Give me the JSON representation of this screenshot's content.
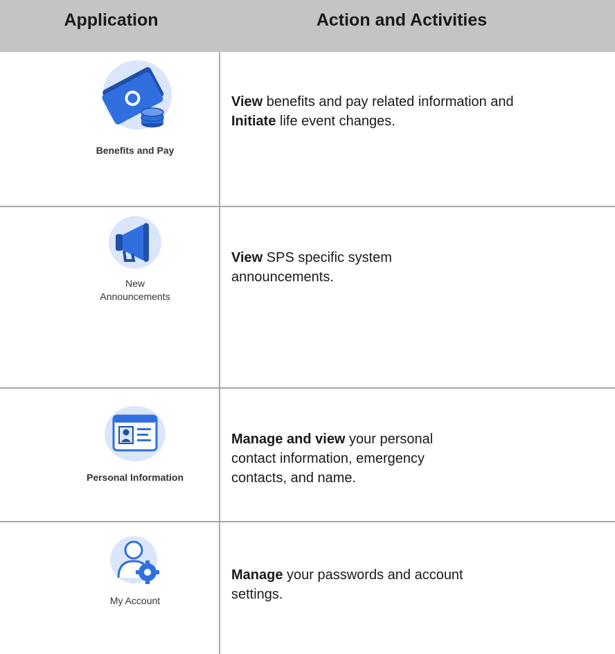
{
  "header": {
    "application": "Application",
    "actions": "Action and Activities"
  },
  "rows": [
    {
      "app_label": "Benefits and Pay",
      "icon": "money-coins-icon",
      "lines": [
        {
          "bold": "View",
          "text": " benefits and pay related information and"
        },
        {
          "bold": "Initiate",
          "text": " life event changes."
        }
      ]
    },
    {
      "app_label_line1": "New",
      "app_label_line2": "Announcements",
      "icon": "megaphone-icon",
      "lines": [
        {
          "bold": "View",
          "text": " SPS specific system"
        },
        {
          "bold": "",
          "text": "announcements."
        }
      ]
    },
    {
      "app_label": "Personal Information",
      "icon": "id-card-icon",
      "lines": [
        {
          "bold": "Manage and view",
          "text": " your personal"
        },
        {
          "bold": "",
          "text": "contact information, emergency"
        },
        {
          "bold": "",
          "text": "contacts, and name."
        }
      ]
    },
    {
      "app_label": "My Account",
      "icon": "user-gear-icon",
      "lines": [
        {
          "bold": "Manage",
          "text": " your passwords and account"
        },
        {
          "bold": "",
          "text": "settings."
        }
      ]
    }
  ],
  "colors": {
    "header_bg": "#c4c4c4",
    "icon_circle": "#dbe6fb",
    "icon_blue": "#2f6fe0",
    "icon_dark": "#1f4fa8"
  }
}
